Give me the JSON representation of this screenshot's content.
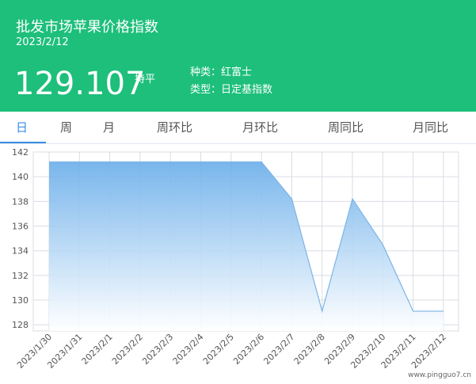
{
  "header": {
    "title": "批发市场苹果价格指数",
    "date": "2023/2/12",
    "price": "129.107",
    "trend": "持平",
    "type_label": "种类：红富士",
    "kind_label": "类型：日定基指数"
  },
  "tabs": [
    {
      "label": "日",
      "active": true
    },
    {
      "label": "周"
    },
    {
      "label": "月"
    },
    {
      "label": "周环比"
    },
    {
      "label": "月环比"
    },
    {
      "label": "周同比"
    },
    {
      "label": "月同比"
    }
  ],
  "chart_data": {
    "type": "area",
    "title": "",
    "xlabel": "",
    "ylabel": "",
    "ylim": [
      127.5,
      142
    ],
    "y_ticks": [
      128,
      130,
      132,
      134,
      136,
      138,
      140,
      142
    ],
    "categories": [
      "2023/1/30",
      "2023/1/31",
      "2023/2/1",
      "2023/2/2",
      "2023/2/3",
      "2023/2/4",
      "2023/2/5",
      "2023/2/6",
      "2023/2/7",
      "2023/2/8",
      "2023/2/9",
      "2023/2/10",
      "2023/2/11",
      "2023/2/12"
    ],
    "series": [
      {
        "values": [
          141.2,
          141.2,
          141.2,
          141.2,
          141.2,
          141.2,
          141.2,
          141.2,
          138.2,
          129.1,
          138.2,
          134.5,
          129.1,
          129.1
        ]
      }
    ],
    "colors": {
      "fill_top": "#6aaeea",
      "fill_bottom": "#ffffff",
      "line": "#7db4e6",
      "grid": "#d9dde3"
    }
  },
  "watermark": "www.pingguo7.cn"
}
